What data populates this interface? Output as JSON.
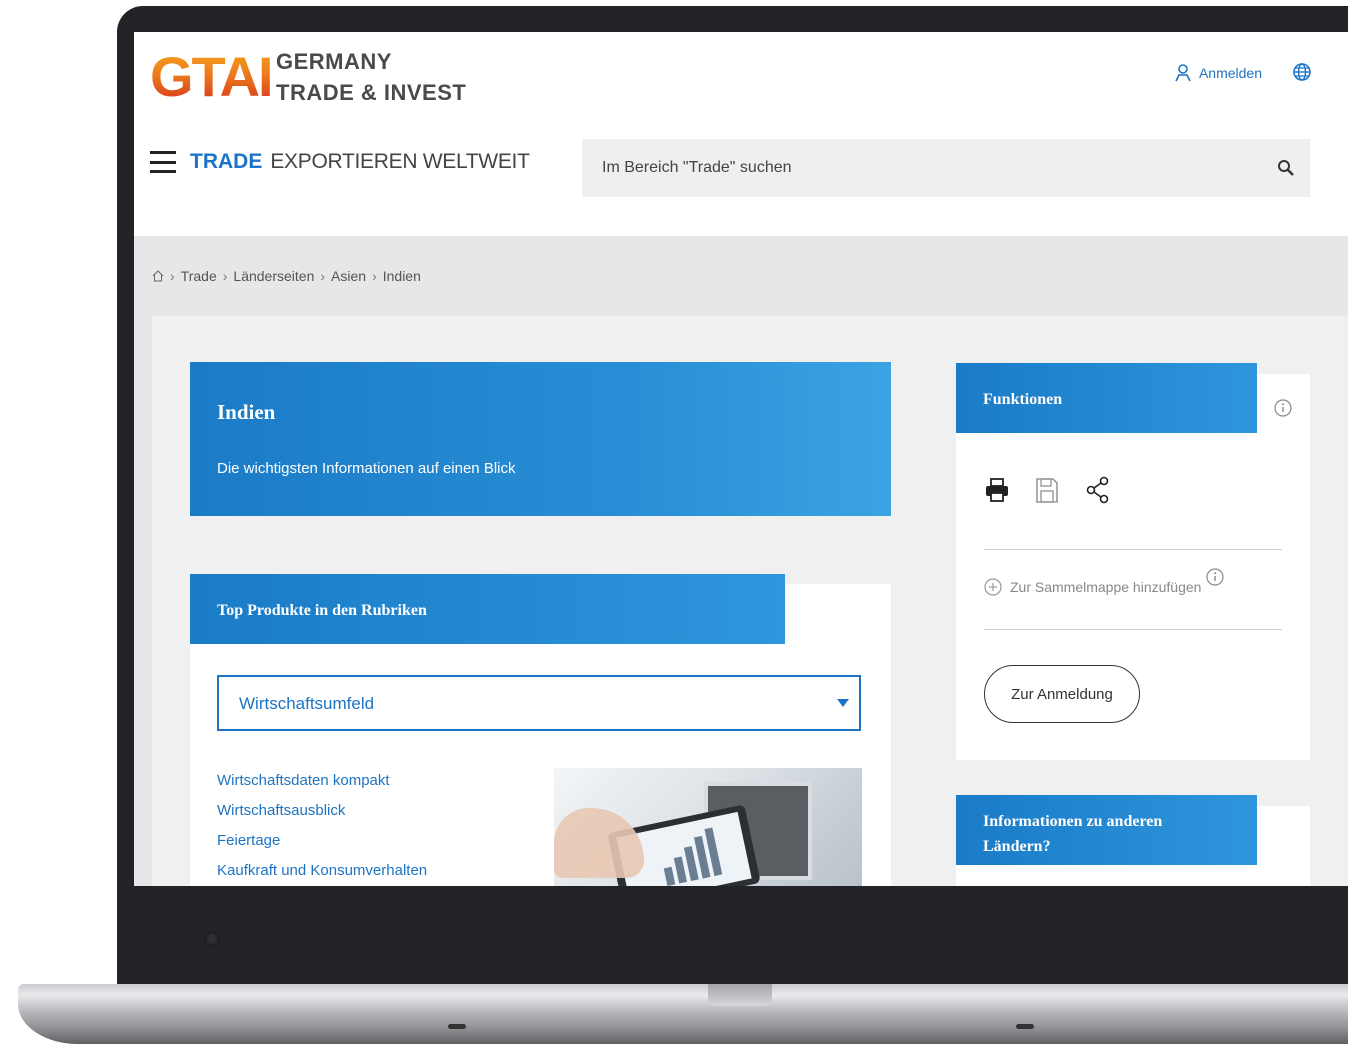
{
  "header": {
    "logo_mark": "GTAI",
    "logo_line1": "GERMANY",
    "logo_line2": "TRADE & INVEST",
    "login_label": "Anmelden"
  },
  "nav": {
    "section": "TRADE",
    "subtitle": "EXPORTIEREN WELTWEIT"
  },
  "search": {
    "placeholder": "Im Bereich \"Trade\" suchen"
  },
  "breadcrumb": {
    "items": [
      "Trade",
      "Länderseiten",
      "Asien",
      "Indien"
    ]
  },
  "hero": {
    "title": "Indien",
    "subtitle": "Die wichtigsten Informationen auf einen Blick"
  },
  "products": {
    "heading": "Top Produkte in den Rubriken",
    "selected": "Wirtschaftsumfeld",
    "links": [
      "Wirtschaftsdaten kompakt",
      "Wirtschaftsausblick",
      "Feiertage",
      "Kaufkraft und Konsumverhalten"
    ]
  },
  "functions": {
    "heading": "Funktionen",
    "collect_label": "Zur Sammelmappe hinzufügen",
    "login_button": "Zur Anmeldung"
  },
  "other_countries": {
    "heading": "Informationen zu anderen Ländern?"
  },
  "colors": {
    "accent": "#1d74c4",
    "header_blue": "#1a7bc7",
    "logo_orange": "#ee7d1c",
    "logo_red": "#d4281d"
  }
}
